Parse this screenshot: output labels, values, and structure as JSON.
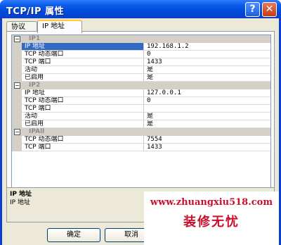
{
  "window": {
    "title": "TCP/IP 属性",
    "help_glyph": "?",
    "close_glyph": "✕"
  },
  "tabs": [
    {
      "label": "协议"
    },
    {
      "label": "IP 地址"
    }
  ],
  "grid": {
    "categories": [
      {
        "name": "IP1",
        "toggle": "−",
        "rows": [
          {
            "prop": "IP 地址",
            "value": "192.168.1.2"
          },
          {
            "prop": "TCP 动态端口",
            "value": "0"
          },
          {
            "prop": "TCP 端口",
            "value": "1433"
          },
          {
            "prop": "活动",
            "value": "是"
          },
          {
            "prop": "已启用",
            "value": "是"
          }
        ]
      },
      {
        "name": "IP2",
        "toggle": "−",
        "rows": [
          {
            "prop": "IP 地址",
            "value": "127.0.0.1"
          },
          {
            "prop": "TCP 动态端口",
            "value": "0"
          },
          {
            "prop": "TCP 端口",
            "value": ""
          },
          {
            "prop": "活动",
            "value": "是"
          },
          {
            "prop": "已启用",
            "value": "是"
          }
        ]
      },
      {
        "name": "IPAll",
        "toggle": "−",
        "rows": [
          {
            "prop": "TCP 动态端口",
            "value": "7554"
          },
          {
            "prop": "TCP 端口",
            "value": "1433"
          }
        ]
      }
    ]
  },
  "description": {
    "title": "IP 地址",
    "text": "IP 地址"
  },
  "buttons": {
    "ok": "确定",
    "cancel": "取消"
  },
  "watermark": {
    "url": "www.zhuangxiu518.com",
    "name": "装修无忧"
  }
}
